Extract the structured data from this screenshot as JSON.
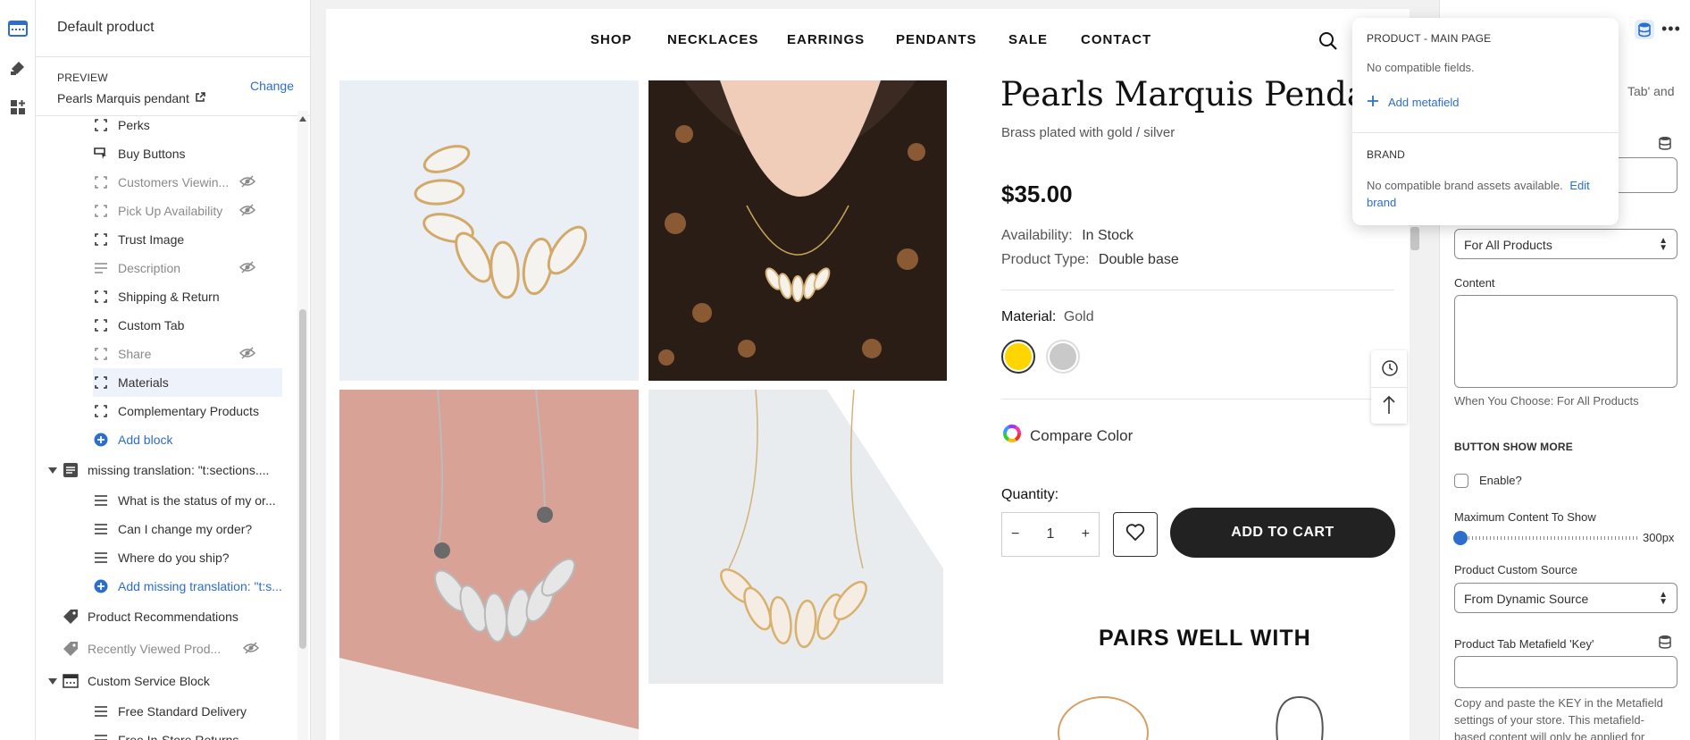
{
  "sidebar": {
    "title": "Default product",
    "preview_label": "PREVIEW",
    "preview_value": "Pearls Marquis pendant",
    "change_label": "Change",
    "items": [
      {
        "label": "Perks",
        "dim": false,
        "hidden": false,
        "icon": "block-icon"
      },
      {
        "label": "Buy Buttons",
        "dim": false,
        "hidden": false,
        "icon": "buy-buttons-icon"
      },
      {
        "label": "Customers Viewin...",
        "dim": true,
        "hidden": true,
        "icon": "block-icon"
      },
      {
        "label": "Pick Up Availability",
        "dim": true,
        "hidden": true,
        "icon": "block-icon"
      },
      {
        "label": "Trust Image",
        "dim": false,
        "hidden": false,
        "icon": "block-icon"
      },
      {
        "label": "Description",
        "dim": true,
        "hidden": true,
        "icon": "text-lines-icon"
      },
      {
        "label": "Shipping & Return",
        "dim": false,
        "hidden": false,
        "icon": "block-icon"
      },
      {
        "label": "Custom Tab",
        "dim": false,
        "hidden": false,
        "icon": "block-icon"
      },
      {
        "label": "Share",
        "dim": true,
        "hidden": true,
        "icon": "block-icon"
      },
      {
        "label": "Materials",
        "dim": false,
        "hidden": false,
        "icon": "block-icon",
        "selected": true
      },
      {
        "label": "Complementary Products",
        "dim": false,
        "hidden": false,
        "icon": "block-icon"
      }
    ],
    "add_block": "Add block",
    "section_missing": "missing translation: \"t:sections....",
    "faq_items": [
      "What is the status of my or...",
      "Can I change my order?",
      "Where do you ship?"
    ],
    "add_missing": "Add missing translation: \"t:s...",
    "product_recommendations": "Product Recommendations",
    "recently_viewed": "Recently Viewed Prod...",
    "custom_service": "Custom Service Block",
    "service_items": [
      "Free Standard Delivery",
      "Free In-Store Returns"
    ]
  },
  "store": {
    "nav": [
      "SHOP",
      "NECKLACES",
      "EARRINGS",
      "PENDANTS",
      "SALE",
      "CONTACT"
    ],
    "product_title": "Pearls Marquis Pendant",
    "subtitle": "Brass plated with gold / silver",
    "price": "$35.00",
    "availability_label": "Availability:",
    "availability_value": "In Stock",
    "type_label": "Product Type:",
    "type_value": "Double base",
    "material_label": "Material:",
    "material_value": "Gold",
    "compare_color": "Compare Color",
    "quantity_label": "Quantity:",
    "quantity_value": "1",
    "minus": "−",
    "plus": "+",
    "add_to_cart": "ADD TO CART",
    "pairs_well": "PAIRS WELL WITH",
    "colors": {
      "gold": "#ffd500",
      "silver": "#c9c9c9"
    }
  },
  "popover": {
    "section1": "PRODUCT - MAIN PAGE",
    "no_fields": "No compatible fields.",
    "add_metafield": "Add metafield",
    "section2": "BRAND",
    "no_brand": "No compatible brand assets available.",
    "edit_link": "Edit",
    "brand_link": "brand"
  },
  "settings": {
    "partial_top": "Tab' and",
    "for_products": "For All Products",
    "content_label": "Content",
    "when_choose": "When You Choose: For All Products",
    "button_show_more": "BUTTON SHOW MORE",
    "enable_label": "Enable?",
    "max_content_label": "Maximum Content To Show",
    "max_content_value": "300px",
    "custom_source_label": "Product Custom Source",
    "custom_source_value": "From Dynamic Source",
    "metafield_key_label": "Product Tab Metafield 'Key'",
    "help_line1": "Copy and paste the KEY in the Metafield",
    "help_line2": "settings of your store. This metafield-",
    "help_line3": "based content will only be applied for"
  }
}
